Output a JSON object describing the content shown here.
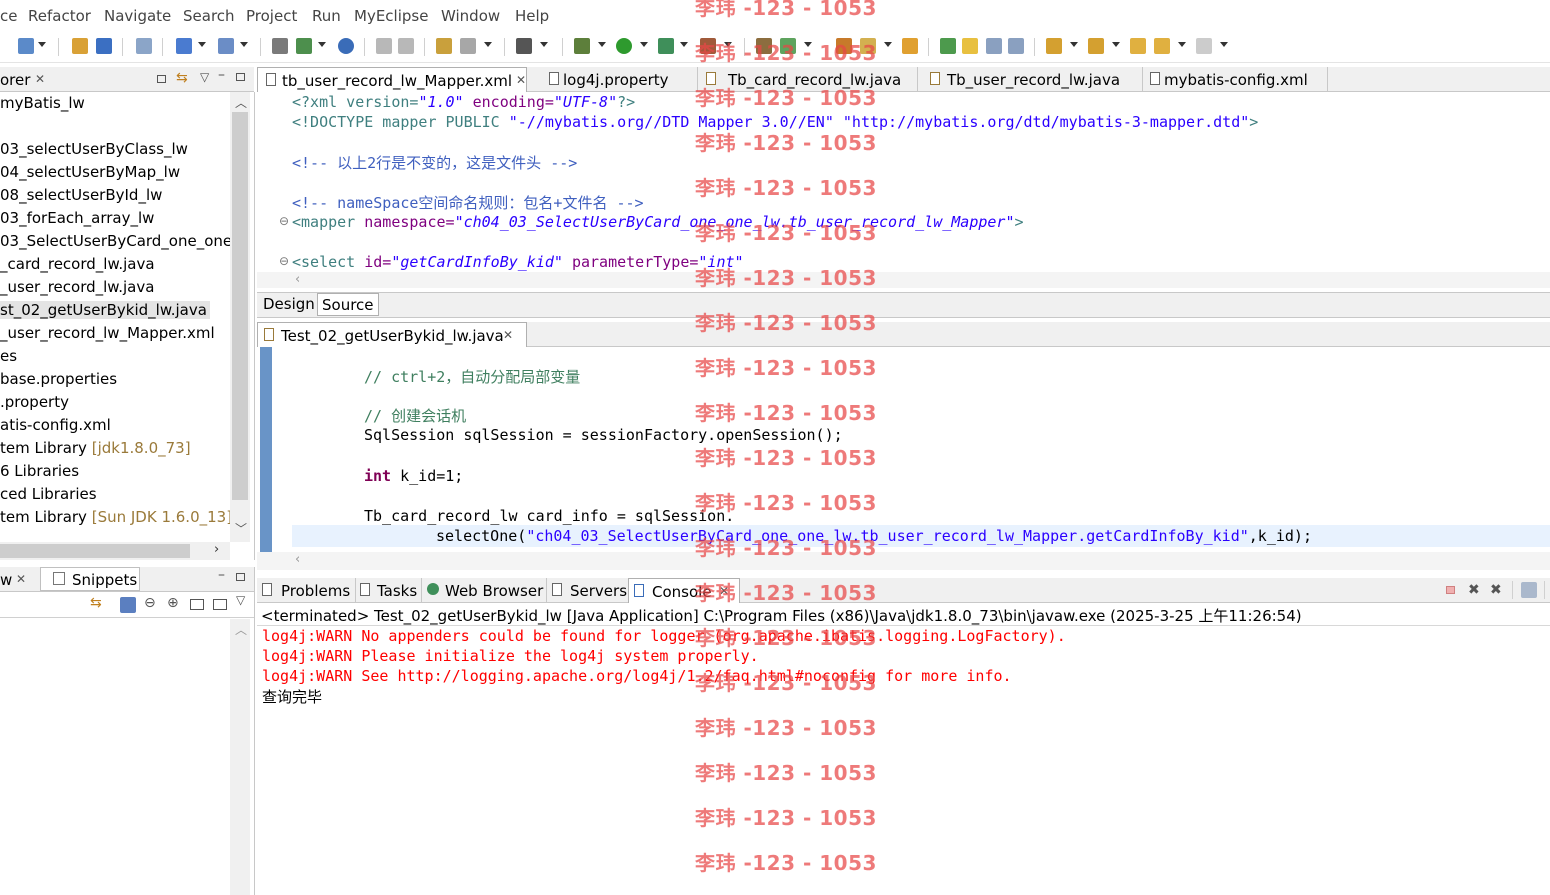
{
  "menu": [
    "ce",
    "Refactor",
    "Navigate",
    "Search",
    "Project",
    "Run",
    "MyEclipse",
    "Window",
    "Help"
  ],
  "explorer": {
    "title": "orer",
    "items": [
      {
        "text": "myBatis_lw",
        "dec": ""
      },
      {
        "text": "",
        "dec": ""
      },
      {
        "text": "03_selectUserByClass_lw",
        "dec": ""
      },
      {
        "text": "04_selectUserByMap_lw",
        "dec": ""
      },
      {
        "text": "08_selectUserById_lw",
        "dec": ""
      },
      {
        "text": "03_forEach_array_lw",
        "dec": ""
      },
      {
        "text": "03_SelectUserByCard_one_one",
        "dec": ""
      },
      {
        "text": "_card_record_lw.java",
        "dec": ""
      },
      {
        "text": "_user_record_lw.java",
        "dec": ""
      },
      {
        "text": "st_02_getUserBykid_lw.java",
        "dec": ""
      },
      {
        "text": "_user_record_lw_Mapper.xml",
        "dec": ""
      },
      {
        "text": "es",
        "dec": ""
      },
      {
        "text": "base.properties",
        "dec": ""
      },
      {
        "text": ".property",
        "dec": ""
      },
      {
        "text": "atis-config.xml",
        "dec": ""
      },
      {
        "text": "tem Library ",
        "dec": "[jdk1.8.0_73]"
      },
      {
        "text": "6 Libraries",
        "dec": ""
      },
      {
        "text": "ced Libraries",
        "dec": ""
      },
      {
        "text": "tem Library ",
        "dec": "[Sun JDK 1.6.0_13]"
      }
    ]
  },
  "left_bottom": {
    "tab1": "w",
    "tab2": "Snippets"
  },
  "editor_tabs": [
    "tb_user_record_lw_Mapper.xml",
    "log4j.property",
    "Tb_card_record_lw.java",
    "Tb_user_record_lw.java",
    "mybatis-config.xml"
  ],
  "xml": {
    "l1_a": "<?xml version=",
    "l1_b": "\"1.0\"",
    "l1_c": " encoding=",
    "l1_d": "\"UTF-8\"",
    "l1_e": "?>",
    "l2_a": "<!DOCTYPE mapper PUBLIC ",
    "l2_b": "\"-//mybatis.org//DTD Mapper 3.0//EN\"",
    "l2_c": " ",
    "l2_d": "\"http://mybatis.org/dtd/mybatis-3-mapper.dtd\"",
    "l2_e": ">",
    "l3": "<!-- 以上2行是不变的，这是文件头 -->",
    "l4": "<!-- nameSpace空间命名规则：包名+文件名 -->",
    "l5_a": "<mapper",
    "l5_b": " namespace=",
    "l5_c": "\"ch04_03_SelectUserByCard_one_one_lw.tb_user_record_lw_Mapper\"",
    "l5_d": ">",
    "l6_a": "<select",
    "l6_b": " id=",
    "l6_c": "\"getCardInfoBy_kid\"",
    "l6_d": " parameterType=",
    "l6_e": "\"int\""
  },
  "design_tabs": [
    "Design",
    "Source"
  ],
  "java_tab": "Test_02_getUserBykid_lw.java",
  "java": {
    "l1": "// ctrl+2，自动分配局部变量",
    "l2": "// 创建会话机",
    "l3": "SqlSession sqlSession = sessionFactory.openSession();",
    "l4_kw": "int",
    "l4_rest": " k_id=1;",
    "l5": "Tb_card_record_lw card_info = sqlSession.",
    "l6_a": "selectOne(",
    "l6_b": "\"ch04_03_SelectUserByCard_one_one_lw.tb_user_record_lw_Mapper.getCardInfoBy_kid\"",
    "l6_c": ",k_id);"
  },
  "bottom_tabs": [
    "Problems",
    "Tasks",
    "Web Browser",
    "Servers",
    "Console"
  ],
  "console": {
    "header": "<terminated> Test_02_getUserBykid_lw [Java Application] C:\\Program Files (x86)\\Java\\jdk1.8.0_73\\bin\\javaw.exe (2025-3-25 上午11:26:54)",
    "lines": [
      "log4j:WARN No appenders could be found for logger (org.apache.ibatis.logging.LogFactory).",
      "log4j:WARN Please initialize the log4j system properly.",
      "log4j:WARN See http://logging.apache.org/log4j/1.2/faq.html#noconfig for more info."
    ],
    "output": "查询完毕"
  },
  "watermark": "李玮 -123 - 1053",
  "colors": {
    "accent": "#4f81bd",
    "error": "#ff0000",
    "watermark": "#e84646"
  }
}
